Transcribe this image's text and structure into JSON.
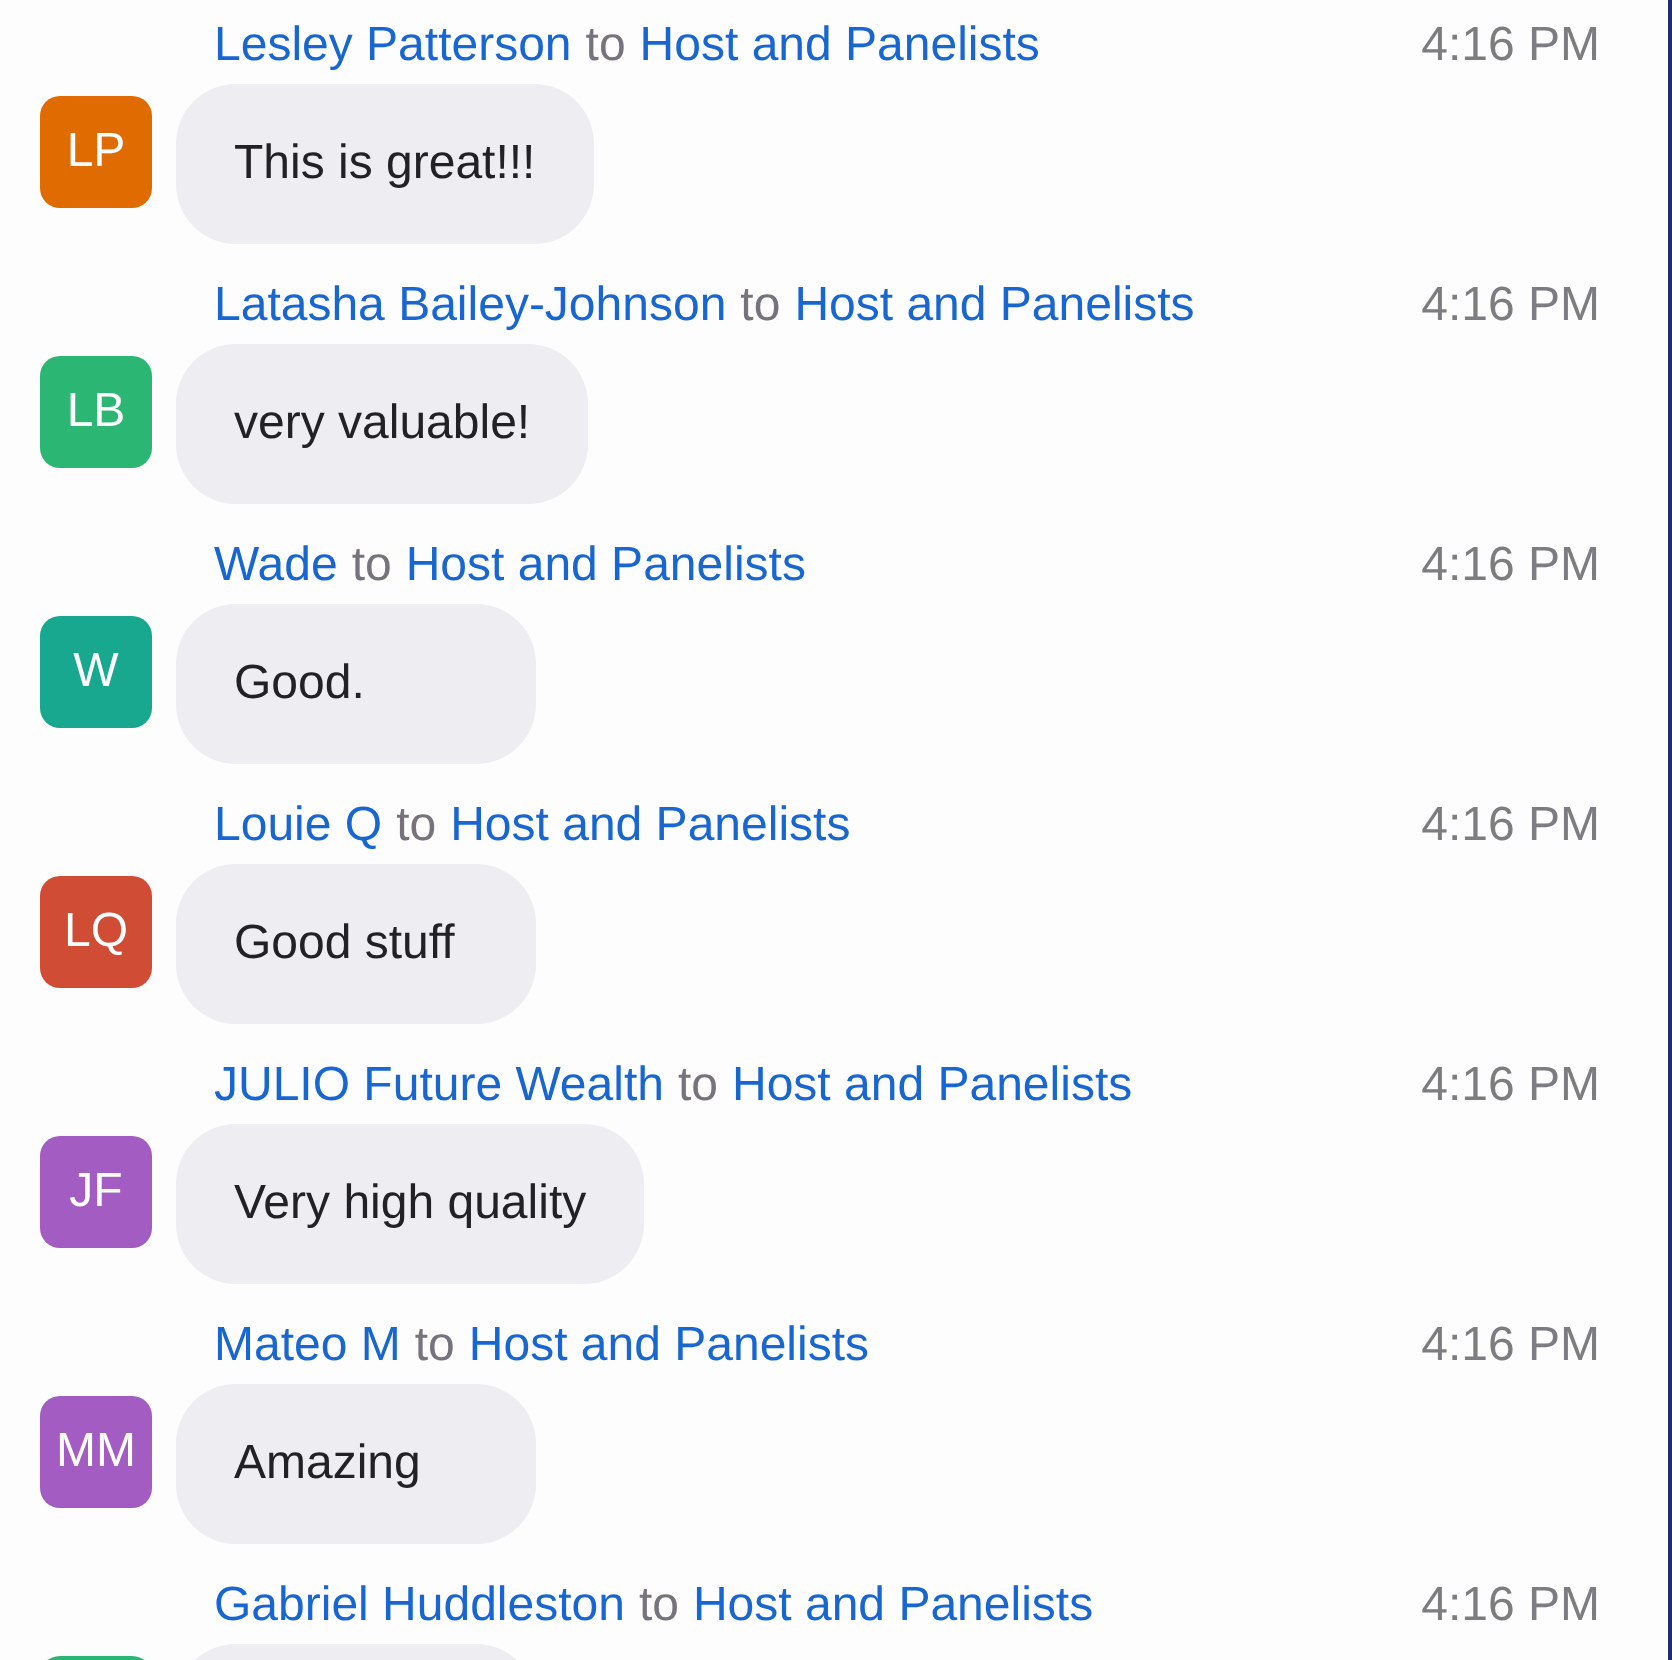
{
  "messages": [
    {
      "sender": "Lesley Patterson",
      "connector": "to",
      "recipient": "Host and Panelists",
      "time": "4:16 PM",
      "initials": "LP",
      "color": "#e06b00",
      "text": "This is great!!!"
    },
    {
      "sender": "Latasha Bailey-Johnson",
      "connector": "to",
      "recipient": "Host and Panelists",
      "time": "4:16 PM",
      "initials": "LB",
      "color": "#2bb673",
      "text": "very valuable!"
    },
    {
      "sender": "Wade",
      "connector": "to",
      "recipient": "Host and Panelists",
      "time": "4:16 PM",
      "initials": "W",
      "color": "#17a88f",
      "text": "Good."
    },
    {
      "sender": "Louie Q",
      "connector": "to",
      "recipient": "Host and Panelists",
      "time": "4:16 PM",
      "initials": "LQ",
      "color": "#d14c34",
      "text": "Good stuff"
    },
    {
      "sender": "JULIO Future Wealth",
      "connector": "to",
      "recipient": "Host and Panelists",
      "time": "4:16 PM",
      "initials": "JF",
      "color": "#a35cc2",
      "text": "Very high quality"
    },
    {
      "sender": "Mateo M",
      "connector": "to",
      "recipient": "Host and Panelists",
      "time": "4:16 PM",
      "initials": "MM",
      "color": "#a35cc2",
      "text": "Amazing"
    },
    {
      "sender": "Gabriel Huddleston",
      "connector": "to",
      "recipient": "Host and Panelists",
      "time": "4:16 PM",
      "color": "#2bb673"
    }
  ]
}
